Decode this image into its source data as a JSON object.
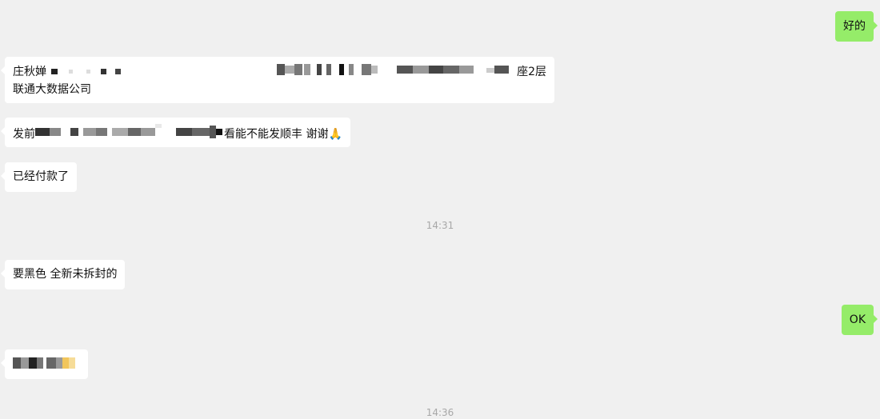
{
  "messages": [
    {
      "side": "out",
      "text": "好的"
    },
    {
      "side": "in",
      "name_text": "庄秋婵",
      "address_suffix": "座2层",
      "line2": "联通大数据公司"
    },
    {
      "side": "in",
      "prefix": "发前",
      "suffix": "看能不能发顺丰 谢谢🙏"
    },
    {
      "side": "in",
      "text": "已经付款了"
    },
    {
      "side": "in",
      "text": "要黑色 全新未拆封的"
    },
    {
      "side": "out",
      "text": "OK"
    },
    {
      "side": "in",
      "text": "🏼"
    }
  ],
  "timestamps": [
    "14:31",
    "14:36"
  ],
  "colors": {
    "background": "#f0f0f0",
    "incoming_bubble": "#ffffff",
    "outgoing_bubble": "#95ec69",
    "timestamp": "#a8a8a8"
  }
}
